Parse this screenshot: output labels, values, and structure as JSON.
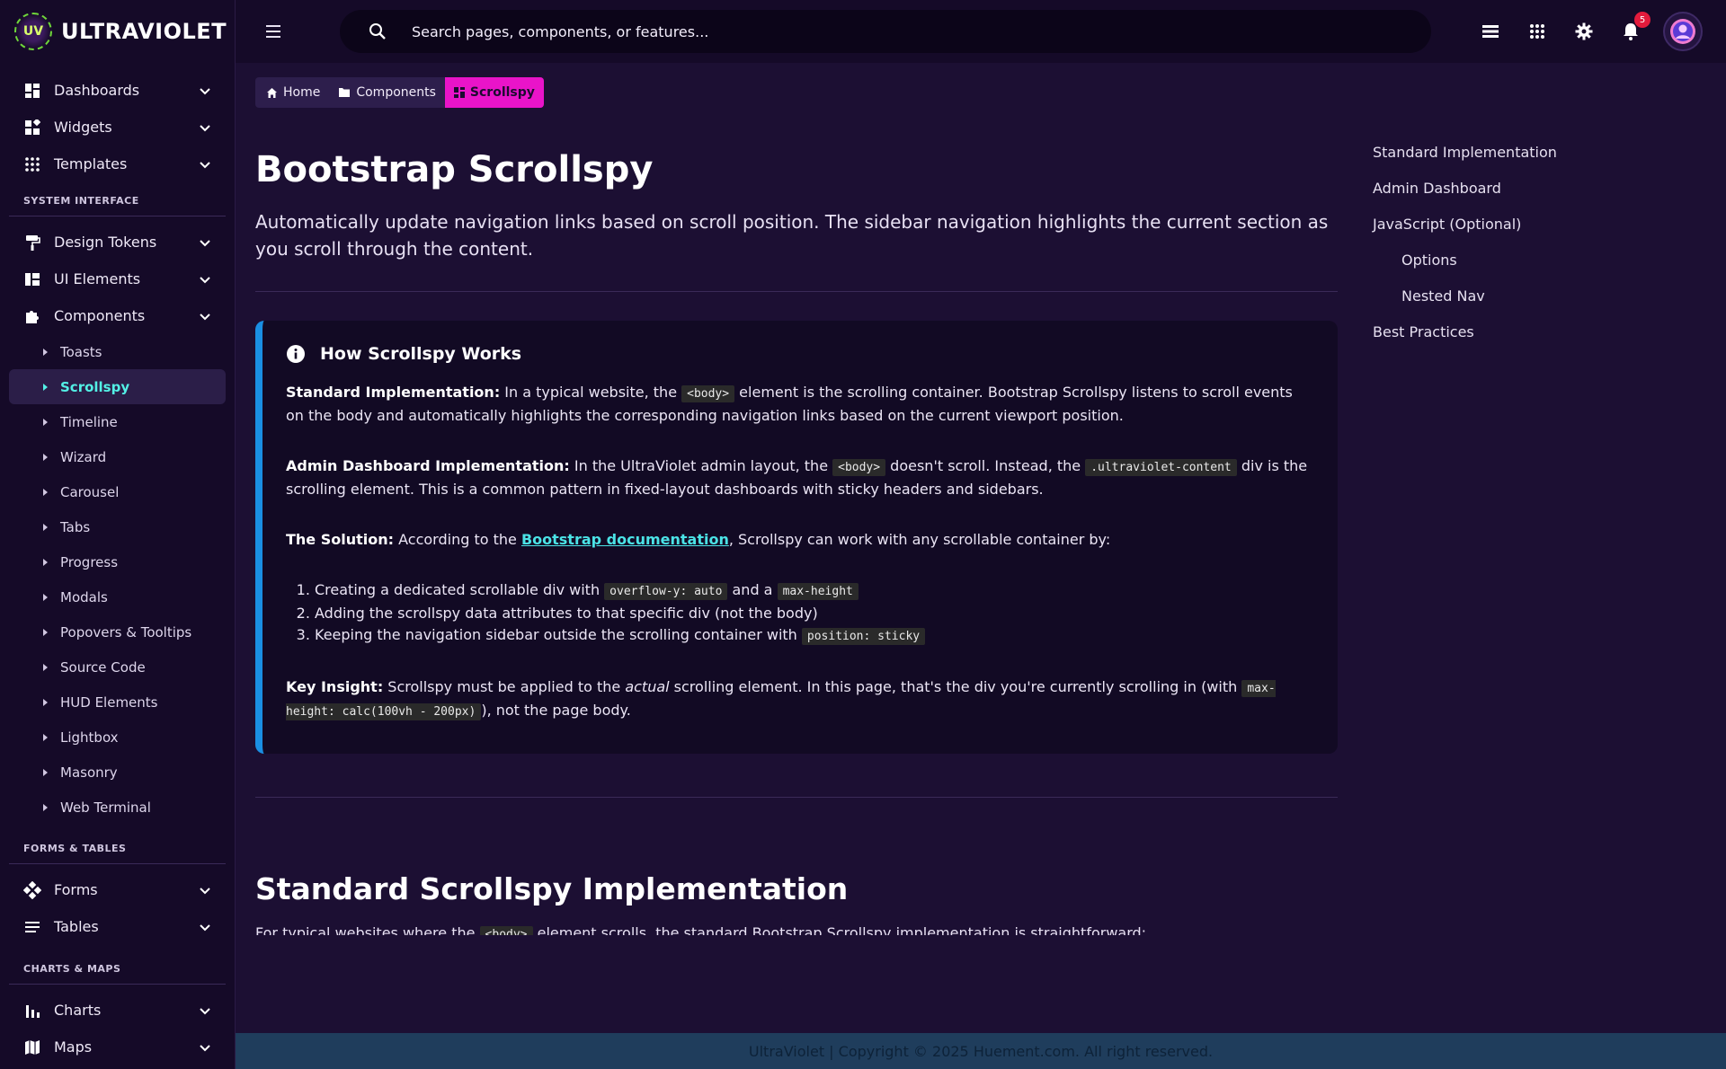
{
  "brand": {
    "name": "ULTRAVIOLET",
    "logo_text": "UV"
  },
  "sidebar": {
    "top_items": [
      {
        "label": "Dashboards",
        "icon": "dashboard-icon"
      },
      {
        "label": "Widgets",
        "icon": "widgets-icon"
      },
      {
        "label": "Templates",
        "icon": "grid-icon"
      }
    ],
    "section_system": "SYSTEM INTERFACE",
    "system_items": [
      {
        "label": "Design Tokens",
        "icon": "paint-roller-icon"
      },
      {
        "label": "UI Elements",
        "icon": "ui-elements-icon"
      },
      {
        "label": "Components",
        "icon": "puzzle-icon"
      }
    ],
    "component_subitems": [
      "Toasts",
      "Scrollspy",
      "Timeline",
      "Wizard",
      "Carousel",
      "Tabs",
      "Progress",
      "Modals",
      "Popovers & Tooltips",
      "Source Code",
      "HUD Elements",
      "Lightbox",
      "Masonry",
      "Web Terminal"
    ],
    "active_subitem": "Scrollspy",
    "section_forms": "FORMS & TABLES",
    "forms_items": [
      {
        "label": "Forms",
        "icon": "forms-icon"
      },
      {
        "label": "Tables",
        "icon": "list-icon"
      }
    ],
    "section_charts": "CHARTS & MAPS",
    "charts_items": [
      {
        "label": "Charts",
        "icon": "bar-chart-icon"
      },
      {
        "label": "Maps",
        "icon": "map-icon"
      }
    ]
  },
  "topbar": {
    "search_placeholder": "Search pages, components, or features...",
    "notification_count": "5"
  },
  "breadcrumb": {
    "home": "Home",
    "components": "Components",
    "current": "Scrollspy"
  },
  "page": {
    "title": "Bootstrap Scrollspy",
    "lead": "Automatically update navigation links based on scroll position. The sidebar navigation highlights the current section as you scroll through the content."
  },
  "callout": {
    "title": "How Scrollspy Works",
    "p1_label": "Standard Implementation:",
    "p1_a": " In a typical website, the ",
    "p1_code": "<body>",
    "p1_b": " element is the scrolling container. Bootstrap Scrollspy listens to scroll events on the body and automatically highlights the corresponding navigation links based on the current viewport position.",
    "p2_label": "Admin Dashboard Implementation:",
    "p2_a": " In the UltraViolet admin layout, the ",
    "p2_code1": "<body>",
    "p2_b": " doesn't scroll. Instead, the ",
    "p2_code2": ".ultraviolet-content",
    "p2_c": " div is the scrolling element. This is a common pattern in fixed-layout dashboards with sticky headers and sidebars.",
    "p3_label": "The Solution:",
    "p3_a": " According to the ",
    "p3_link": "Bootstrap documentation",
    "p3_b": ", Scrollspy can work with any scrollable container by:",
    "li1_a": "Creating a dedicated scrollable div with ",
    "li1_code1": "overflow-y: auto",
    "li1_b": " and a ",
    "li1_code2": "max-height",
    "li2": "Adding the scrollspy data attributes to that specific div (not the body)",
    "li3_a": "Keeping the navigation sidebar outside the scrolling container with ",
    "li3_code": "position: sticky",
    "p4_label": "Key Insight:",
    "p4_a": " Scrollspy must be applied to the ",
    "p4_em": "actual",
    "p4_b": " scrolling element. In this page, that's the div you're currently scrolling in (with ",
    "p4_code": "max-height: calc(100vh - 200px)",
    "p4_c": "), not the page body."
  },
  "section2": {
    "title": "Standard Scrollspy Implementation",
    "lead_a": "For typical websites where the ",
    "lead_code": "<body>",
    "lead_b": " element scrolls, the standard Bootstrap Scrollspy implementation is straightforward:"
  },
  "toc": [
    {
      "label": "Standard Implementation",
      "level": 1
    },
    {
      "label": "Admin Dashboard",
      "level": 1
    },
    {
      "label": "JavaScript (Optional)",
      "level": 1
    },
    {
      "label": "Options",
      "level": 2
    },
    {
      "label": "Nested Nav",
      "level": 2
    },
    {
      "label": "Best Practices",
      "level": 1
    }
  ],
  "footer": "UltraViolet | Copyright © 2025 Huement.com. All right reserved.",
  "colors": {
    "accent": "#e914c9",
    "active_link": "#53f0e5",
    "callout_border": "#1a8fe3"
  }
}
